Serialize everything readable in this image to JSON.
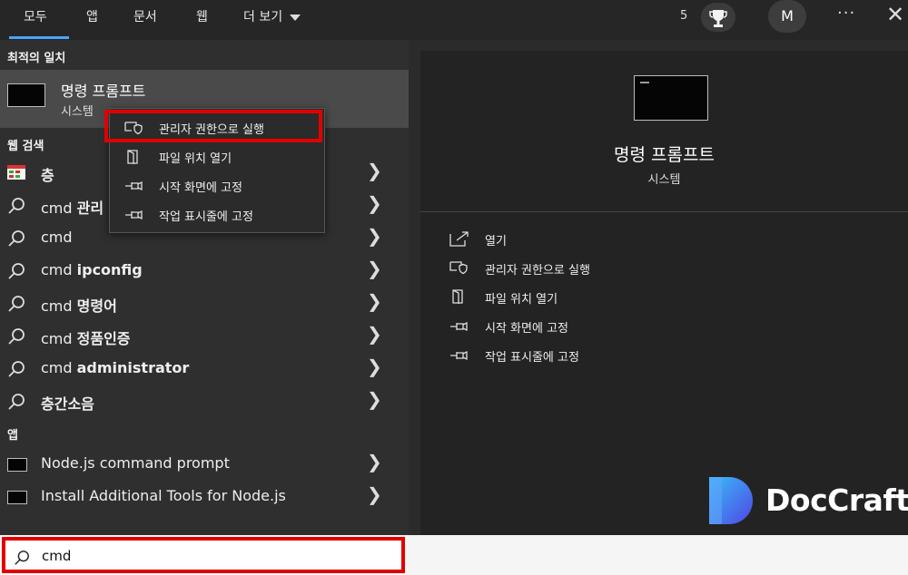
{
  "tabs": [
    {
      "label": "모두"
    },
    {
      "label": "앱"
    },
    {
      "label": "문서"
    },
    {
      "label": "웹"
    },
    {
      "label": "더 보기"
    }
  ],
  "header": {
    "points": "5",
    "avatar_initial": "M",
    "more": "···",
    "close": "✕"
  },
  "sections": {
    "best_match": "최적의 일치",
    "web": "웹 검색",
    "apps": "앱"
  },
  "best_match": {
    "title": "명령 프롬프트",
    "subtitle": "시스템"
  },
  "context_menu": [
    {
      "label": "관리자 권한으로 실행",
      "icon": "shield-icon"
    },
    {
      "label": "파일 위치 열기",
      "icon": "folder-icon"
    },
    {
      "label": "시작 화면에 고정",
      "icon": "pin-icon"
    },
    {
      "label": "작업 표시줄에 고정",
      "icon": "pin-icon"
    }
  ],
  "web_results": [
    {
      "prefix": "",
      "bold": "층",
      "icon": "web-thumbnail-icon"
    },
    {
      "prefix": "cmd ",
      "bold": "관리",
      "icon": "search-icon"
    },
    {
      "prefix": "cmd",
      "bold": "",
      "icon": "search-icon"
    },
    {
      "prefix": "cmd ",
      "bold": "ipconfig",
      "icon": "search-icon"
    },
    {
      "prefix": "cmd ",
      "bold": "명령어",
      "icon": "search-icon"
    },
    {
      "prefix": "cmd ",
      "bold": "정품인증",
      "icon": "search-icon"
    },
    {
      "prefix": "cmd ",
      "bold": "administrator",
      "icon": "search-icon"
    },
    {
      "prefix": "",
      "bold": "층간소음",
      "icon": "search-icon"
    }
  ],
  "apps": [
    {
      "label": "Node.js command prompt",
      "icon": "terminal-icon"
    },
    {
      "label": "Install Additional Tools for Node.js",
      "icon": "terminal-icon"
    }
  ],
  "preview": {
    "title": "명령 프롬프트",
    "subtitle": "시스템",
    "actions": [
      {
        "label": "열기",
        "icon": "open-icon"
      },
      {
        "label": "관리자 권한으로 실행",
        "icon": "shield-icon"
      },
      {
        "label": "파일 위치 열기",
        "icon": "folder-icon"
      },
      {
        "label": "시작 화면에 고정",
        "icon": "pin-icon"
      },
      {
        "label": "작업 표시줄에 고정",
        "icon": "pin-icon"
      }
    ]
  },
  "watermark": {
    "text": "DocCraft"
  },
  "search": {
    "value": "cmd"
  },
  "colors": {
    "highlight": "#e10000",
    "accent": "#4da3ff",
    "logo": "#3b82f6"
  }
}
